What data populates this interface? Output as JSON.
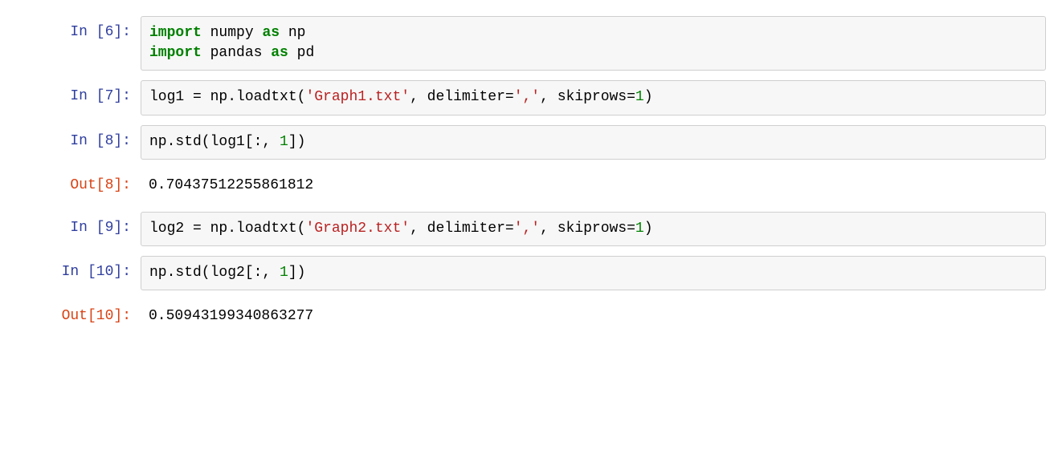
{
  "cells": [
    {
      "in_prompt": "In [6]:",
      "code": {
        "l1_kw1": "import",
        "l1_mod": " numpy ",
        "l1_kw2": "as",
        "l1_alias": " np",
        "l2_kw1": "import",
        "l2_mod": " pandas ",
        "l2_kw2": "as",
        "l2_alias": " pd"
      }
    },
    {
      "in_prompt": "In [7]:",
      "code": {
        "pre": "log1 = np.loadtxt(",
        "str1": "'Graph1.txt'",
        "mid1": ", delimiter=",
        "str2": "','",
        "mid2": ", skiprows=",
        "num": "1",
        "post": ")"
      }
    },
    {
      "in_prompt": "In [8]:",
      "code": {
        "pre": "np.std(log1[:, ",
        "num": "1",
        "post": "])"
      },
      "out_prompt": "Out[8]:",
      "output": "0.70437512255861812"
    },
    {
      "in_prompt": "In [9]:",
      "code": {
        "pre": "log2 = np.loadtxt(",
        "str1": "'Graph2.txt'",
        "mid1": ", delimiter=",
        "str2": "','",
        "mid2": ", skiprows=",
        "num": "1",
        "post": ")"
      }
    },
    {
      "in_prompt": "In [10]:",
      "code": {
        "pre": "np.std(log2[:, ",
        "num": "1",
        "post": "])"
      },
      "out_prompt": "Out[10]:",
      "output": "0.50943199340863277"
    }
  ]
}
